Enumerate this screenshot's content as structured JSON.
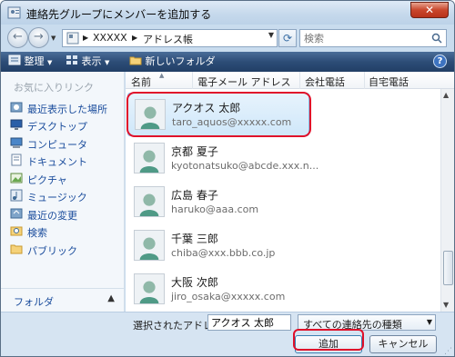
{
  "window": {
    "title": "連絡先グループにメンバーを追加する",
    "close_glyph": "✕"
  },
  "address": {
    "crumbs": [
      "XXXXX",
      "アドレス帳"
    ],
    "separator": "▶",
    "search_placeholder": "検索"
  },
  "toolbar": {
    "organize": "整理",
    "view": "表示",
    "new_folder": "新しいフォルダ",
    "help": "?"
  },
  "sidebar": {
    "header": "お気に入りリンク",
    "items": [
      {
        "label": "最近表示した場所",
        "icon": "recent-places-icon"
      },
      {
        "label": "デスクトップ",
        "icon": "desktop-icon"
      },
      {
        "label": "コンピュータ",
        "icon": "computer-icon"
      },
      {
        "label": "ドキュメント",
        "icon": "documents-icon"
      },
      {
        "label": "ピクチャ",
        "icon": "pictures-icon"
      },
      {
        "label": "ミュージック",
        "icon": "music-icon"
      },
      {
        "label": "最近の変更",
        "icon": "recent-changes-icon"
      },
      {
        "label": "検索",
        "icon": "search-folder-icon"
      },
      {
        "label": "パブリック",
        "icon": "public-folder-icon"
      }
    ],
    "folders_label": "フォルダ",
    "folders_arrow": "▲"
  },
  "list": {
    "columns": [
      "名前",
      "電子メール アドレス",
      "会社電話",
      "自宅電話"
    ],
    "contacts": [
      {
        "name": "アクオス 太郎",
        "email": "taro_aquos@xxxxx.com",
        "selected": true
      },
      {
        "name": "京都 夏子",
        "email": "kyotonatsuko@abcde.xxx.n...",
        "selected": false
      },
      {
        "name": "広島 春子",
        "email": "haruko@aaa.com",
        "selected": false
      },
      {
        "name": "千葉 三郎",
        "email": "chiba@xxx.bbb.co.jp",
        "selected": false
      },
      {
        "name": "大阪 次郎",
        "email": "jiro_osaka@xxxxx.com",
        "selected": false
      }
    ]
  },
  "footer": {
    "selected_label": "選択されたアドレス帳:",
    "selected_value": "アクオス 太郎",
    "type_filter": "すべての連絡先の種類",
    "add_button": "追加",
    "cancel_button": "キャンセル"
  },
  "colors": {
    "selection_ring": "#e0102a",
    "toolbar": "#2d4d77",
    "link": "#1a4c9c"
  }
}
